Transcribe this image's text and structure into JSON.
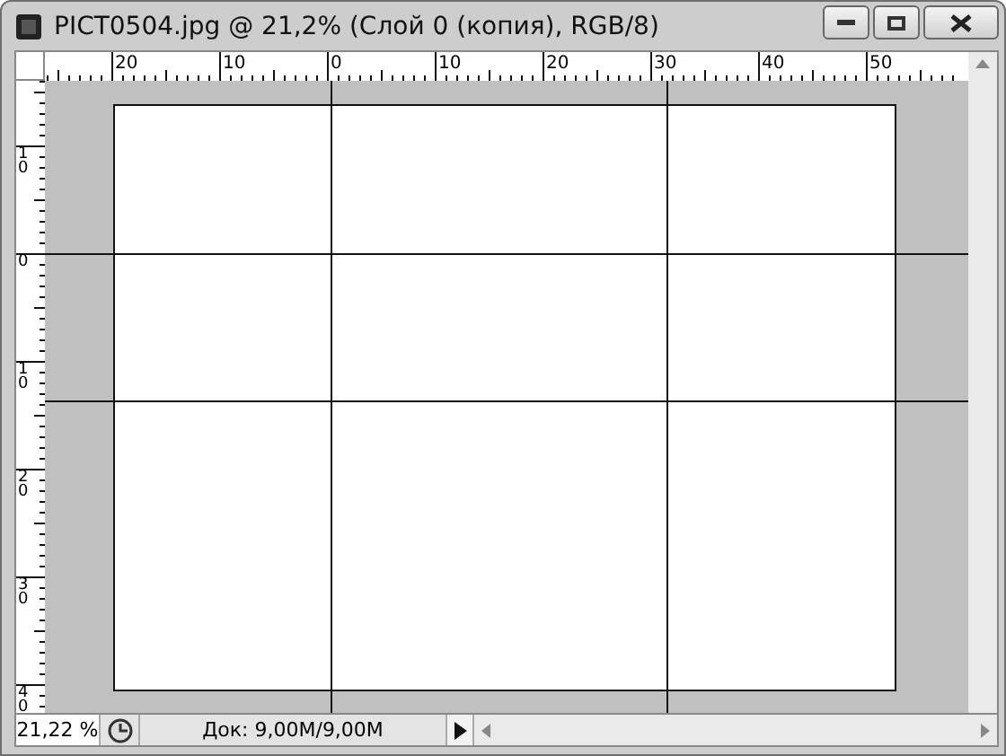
{
  "window": {
    "title": "PICT0504.jpg @ 21,2% (Слой 0 (копия), RGB/8)"
  },
  "rulers": {
    "horizontal_labels": [
      "20",
      "10",
      "0",
      "10",
      "20",
      "30",
      "40",
      "50"
    ],
    "vertical_labels": [
      "10",
      "0",
      "10",
      "20",
      "30",
      "40"
    ]
  },
  "status_bar": {
    "zoom": "21,22 %",
    "document_info": "Док: 9,00M/9,00M"
  }
}
